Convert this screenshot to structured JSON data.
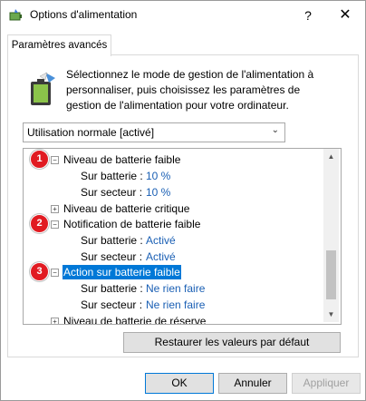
{
  "window": {
    "title": "Options d'alimentation",
    "help": "?",
    "close": "✕"
  },
  "tabs": [
    {
      "label": "Paramètres avancés",
      "active": true
    }
  ],
  "description": "Sélectionnez le mode de gestion de l'alimentation à personnaliser, puis choisissez les paramètres de gestion de l'alimentation pour votre ordinateur.",
  "plan_select": {
    "value": "Utilisation normale [activé]"
  },
  "tree": {
    "items": [
      {
        "label": "Niveau de batterie faible",
        "expanded": true,
        "badge": "1",
        "children": [
          {
            "label": "Sur batterie :",
            "value": "10  %"
          },
          {
            "label": "Sur secteur :",
            "value": "10  %"
          }
        ]
      },
      {
        "label": "Niveau de batterie critique",
        "expanded": false
      },
      {
        "label": "Notification de batterie faible",
        "expanded": true,
        "badge": "2",
        "children": [
          {
            "label": "Sur batterie :",
            "value": "Activé"
          },
          {
            "label": "Sur secteur :",
            "value": "Activé"
          }
        ]
      },
      {
        "label": "Action sur batterie faible",
        "expanded": true,
        "selected": true,
        "badge": "3",
        "children": [
          {
            "label": "Sur batterie :",
            "value": "Ne rien faire"
          },
          {
            "label": "Sur secteur :",
            "value": "Ne rien faire"
          }
        ]
      },
      {
        "label": "Niveau de batterie de réserve",
        "expanded": false
      }
    ]
  },
  "buttons": {
    "restore": "Restaurer les valeurs par défaut",
    "ok": "OK",
    "cancel": "Annuler",
    "apply": "Appliquer"
  },
  "colors": {
    "value_link": "#1a5fb4",
    "selection": "#0078d7",
    "badge": "#e11b22"
  }
}
